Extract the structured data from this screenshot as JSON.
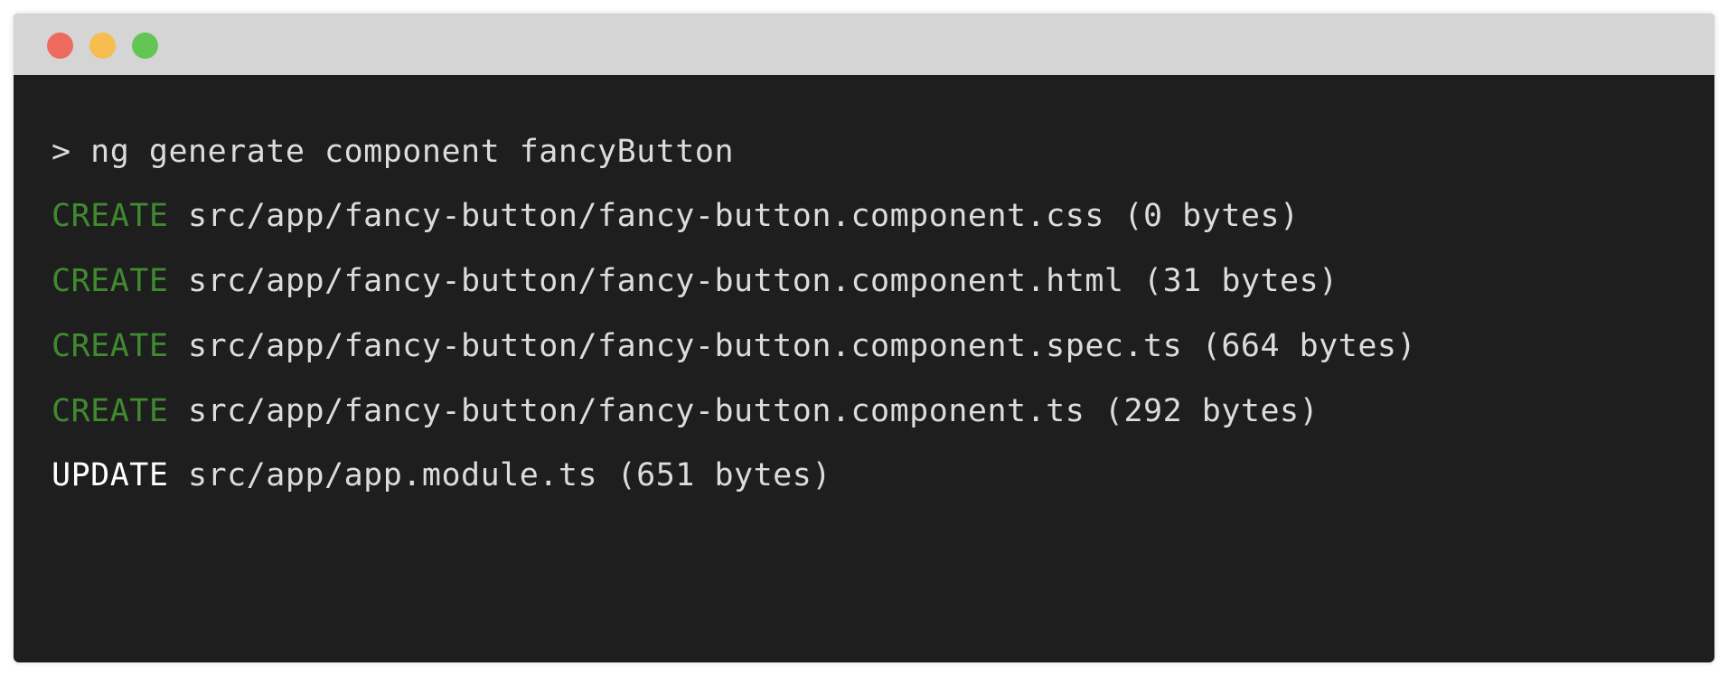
{
  "window": {
    "controls": {
      "close_color": "#ee6a5f",
      "minimize_color": "#f5be4f",
      "maximize_color": "#62c554"
    },
    "background": "#1e1e1e",
    "titlebar_color": "#d5d5d5"
  },
  "terminal": {
    "command": {
      "prompt": ">",
      "text": "ng generate component fancyButton"
    },
    "output": [
      {
        "action": "CREATE",
        "action_color": "#3f8a2f",
        "text": "src/app/fancy-button/fancy-button.component.css (0 bytes)"
      },
      {
        "action": "CREATE",
        "action_color": "#3f8a2f",
        "text": "src/app/fancy-button/fancy-button.component.html (31 bytes)"
      },
      {
        "action": "CREATE",
        "action_color": "#3f8a2f",
        "text": "src/app/fancy-button/fancy-button.component.spec.ts (664 bytes)"
      },
      {
        "action": "CREATE",
        "action_color": "#3f8a2f",
        "text": "src/app/fancy-button/fancy-button.component.ts (292 bytes)"
      },
      {
        "action": "UPDATE",
        "action_color": "#ffffff",
        "text": "src/app/app.module.ts (651 bytes)"
      }
    ],
    "text_color": "#dcdcdc"
  }
}
